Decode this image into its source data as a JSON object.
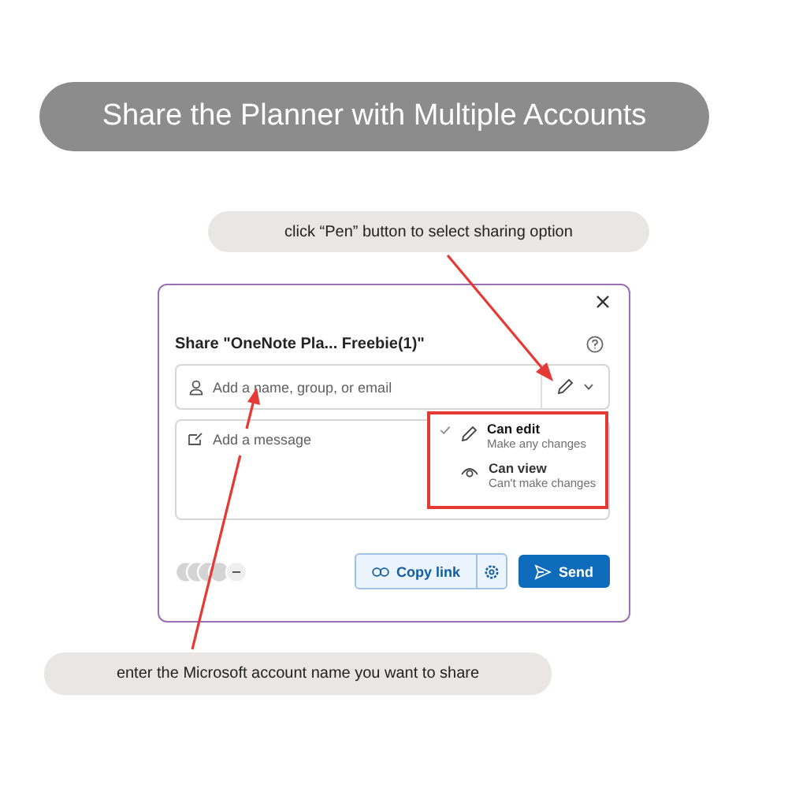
{
  "heading": "Share the Planner with Multiple Accounts",
  "callouts": [
    {
      "text": "click “Pen” button to select sharing option"
    },
    {
      "text": "enter the Microsoft account name you want to share"
    }
  ],
  "dialog": {
    "title": "Share \"OneNote Pla... Freebie(1)\"",
    "recipient_placeholder": "Add a name, group, or email",
    "message_placeholder": "Add a message",
    "permissions": [
      {
        "kind": "edit",
        "label": "Can edit",
        "description": "Make any changes",
        "selected": true
      },
      {
        "kind": "view",
        "label": "Can view",
        "description": "Can't make changes",
        "selected": false
      }
    ],
    "copy_link": "Copy link",
    "send": "Send"
  }
}
